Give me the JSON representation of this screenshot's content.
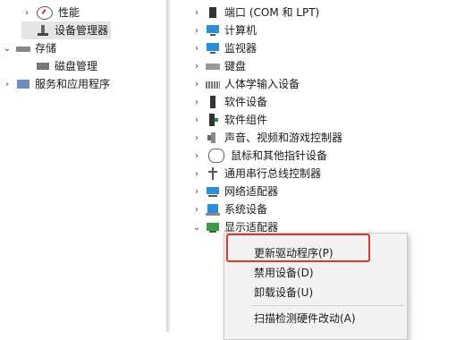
{
  "left_tree": {
    "items": [
      {
        "label": "性能",
        "icon": "performance-gauge-icon",
        "chevron": ">"
      },
      {
        "label": "设备管理器",
        "icon": "device-manager-icon",
        "chevron": ""
      },
      {
        "label": "存储",
        "icon": "storage-icon",
        "chevron": "v"
      },
      {
        "label": "磁盘管理",
        "icon": "disk-management-icon",
        "chevron": ""
      },
      {
        "label": "服务和应用程序",
        "icon": "services-icon",
        "chevron": ">"
      }
    ]
  },
  "device_tree": {
    "items": [
      {
        "label": "端口 (COM 和 LPT)",
        "icon": "port-icon",
        "chevron": ">"
      },
      {
        "label": "计算机",
        "icon": "computer-icon",
        "chevron": ">"
      },
      {
        "label": "监视器",
        "icon": "monitor-icon",
        "chevron": ">"
      },
      {
        "label": "键盘",
        "icon": "keyboard-icon",
        "chevron": ">"
      },
      {
        "label": "人体学输入设备",
        "icon": "hid-icon",
        "chevron": ">"
      },
      {
        "label": "软件设备",
        "icon": "software-device-icon",
        "chevron": ">"
      },
      {
        "label": "软件组件",
        "icon": "software-component-icon",
        "chevron": ">"
      },
      {
        "label": "声音、视频和游戏控制器",
        "icon": "sound-icon",
        "chevron": ">"
      },
      {
        "label": "鼠标和其他指针设备",
        "icon": "mouse-icon",
        "chevron": ">"
      },
      {
        "label": "通用串行总线控制器",
        "icon": "usb-icon",
        "chevron": ">"
      },
      {
        "label": "网络适配器",
        "icon": "network-adapter-icon",
        "chevron": ">"
      },
      {
        "label": "系统设备",
        "icon": "system-device-icon",
        "chevron": ">"
      },
      {
        "label": "显示适配器",
        "icon": "display-adapter-icon",
        "chevron": "v"
      }
    ]
  },
  "context_menu": {
    "items": [
      {
        "label": "更新驱动程序(P)"
      },
      {
        "label": "禁用设备(D)"
      },
      {
        "label": "卸载设备(U)"
      },
      {
        "label": "扫描检测硬件改动(A)"
      }
    ]
  },
  "colors": {
    "highlight_border": "#d9382c",
    "selected_bg": "#e5e5e5",
    "menu_bg": "#f2f2f2"
  }
}
